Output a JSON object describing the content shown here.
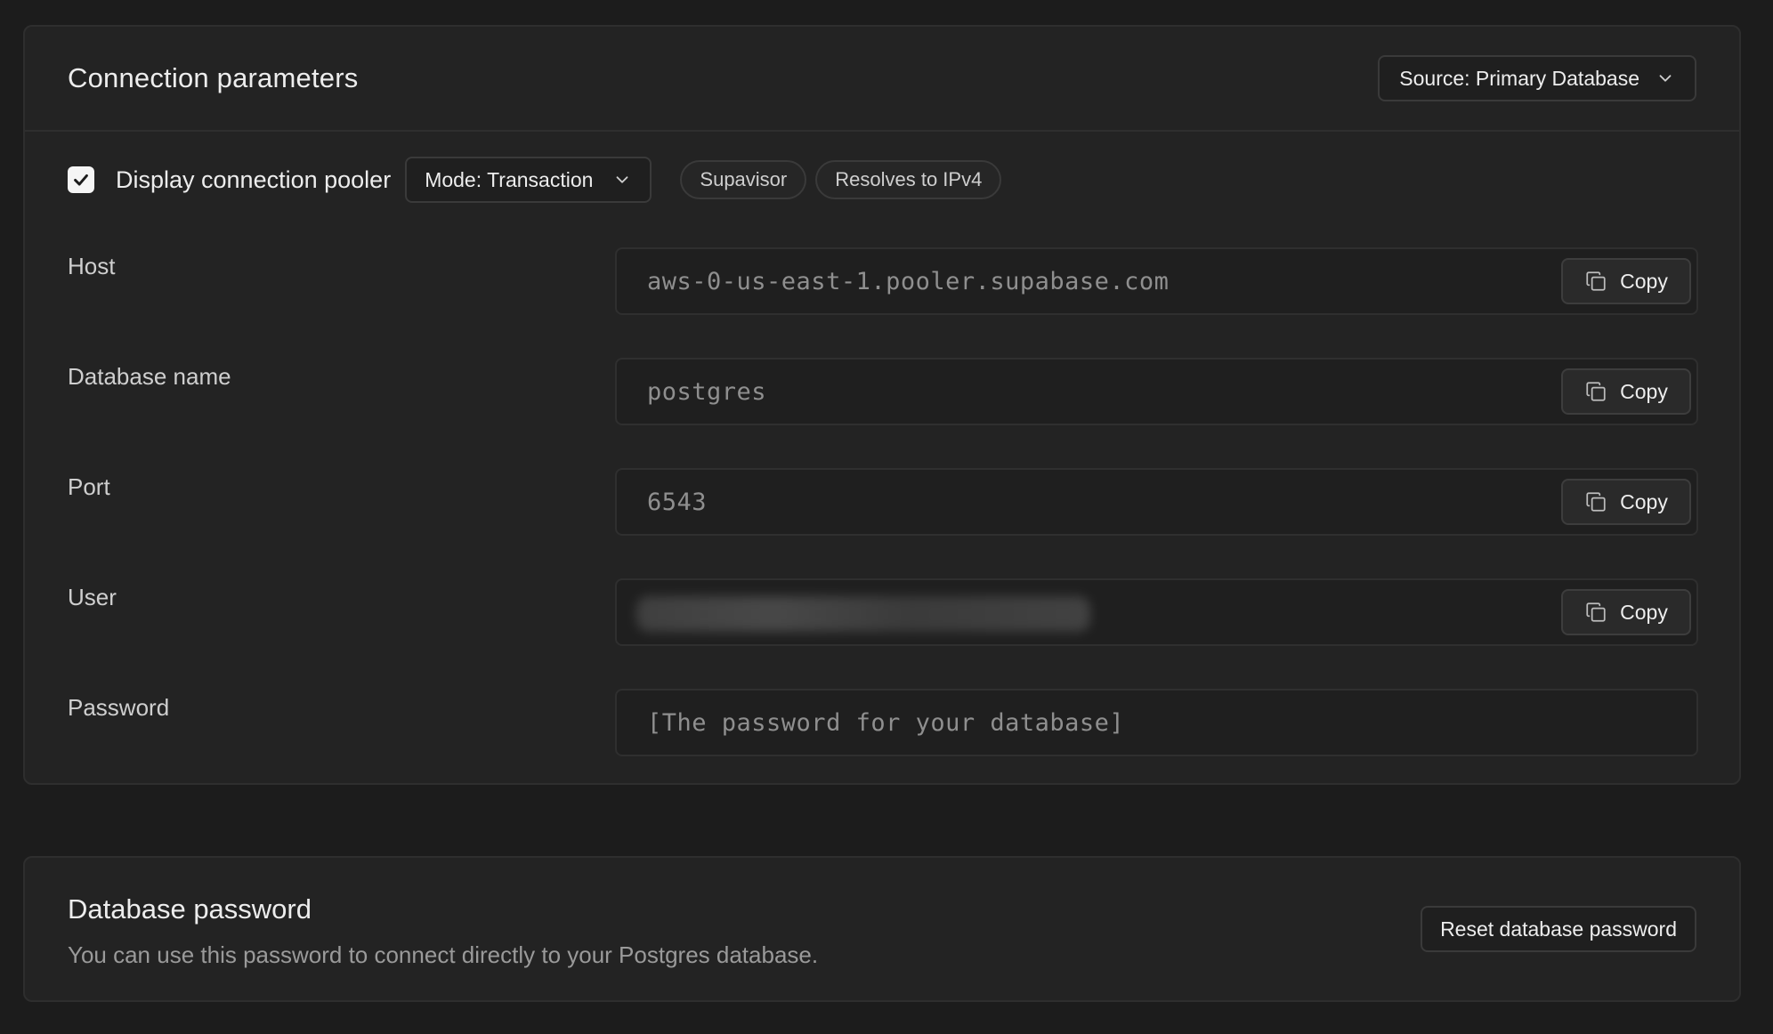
{
  "connection_parameters": {
    "title": "Connection parameters",
    "source_select": {
      "value": "Source: Primary Database",
      "icon": "chevron-down-icon"
    },
    "pooler": {
      "checkbox_checked": true,
      "label": "Display connection pooler",
      "mode_select": {
        "value": "Mode: Transaction",
        "icon": "chevron-down-icon"
      },
      "badges": [
        "Supavisor",
        "Resolves to IPv4"
      ]
    },
    "fields": {
      "host": {
        "label": "Host",
        "value": "aws-0-us-east-1.pooler.supabase.com",
        "copy_label": "Copy"
      },
      "database_name": {
        "label": "Database name",
        "value": "postgres",
        "copy_label": "Copy"
      },
      "port": {
        "label": "Port",
        "value": "6543",
        "copy_label": "Copy"
      },
      "user": {
        "label": "User",
        "value_blurred": true,
        "copy_label": "Copy"
      },
      "password": {
        "label": "Password",
        "value": "[The password for your database]"
      }
    }
  },
  "database_password": {
    "title": "Database password",
    "description": "You can use this password to connect directly to your Postgres database.",
    "reset_button_label": "Reset database password"
  }
}
